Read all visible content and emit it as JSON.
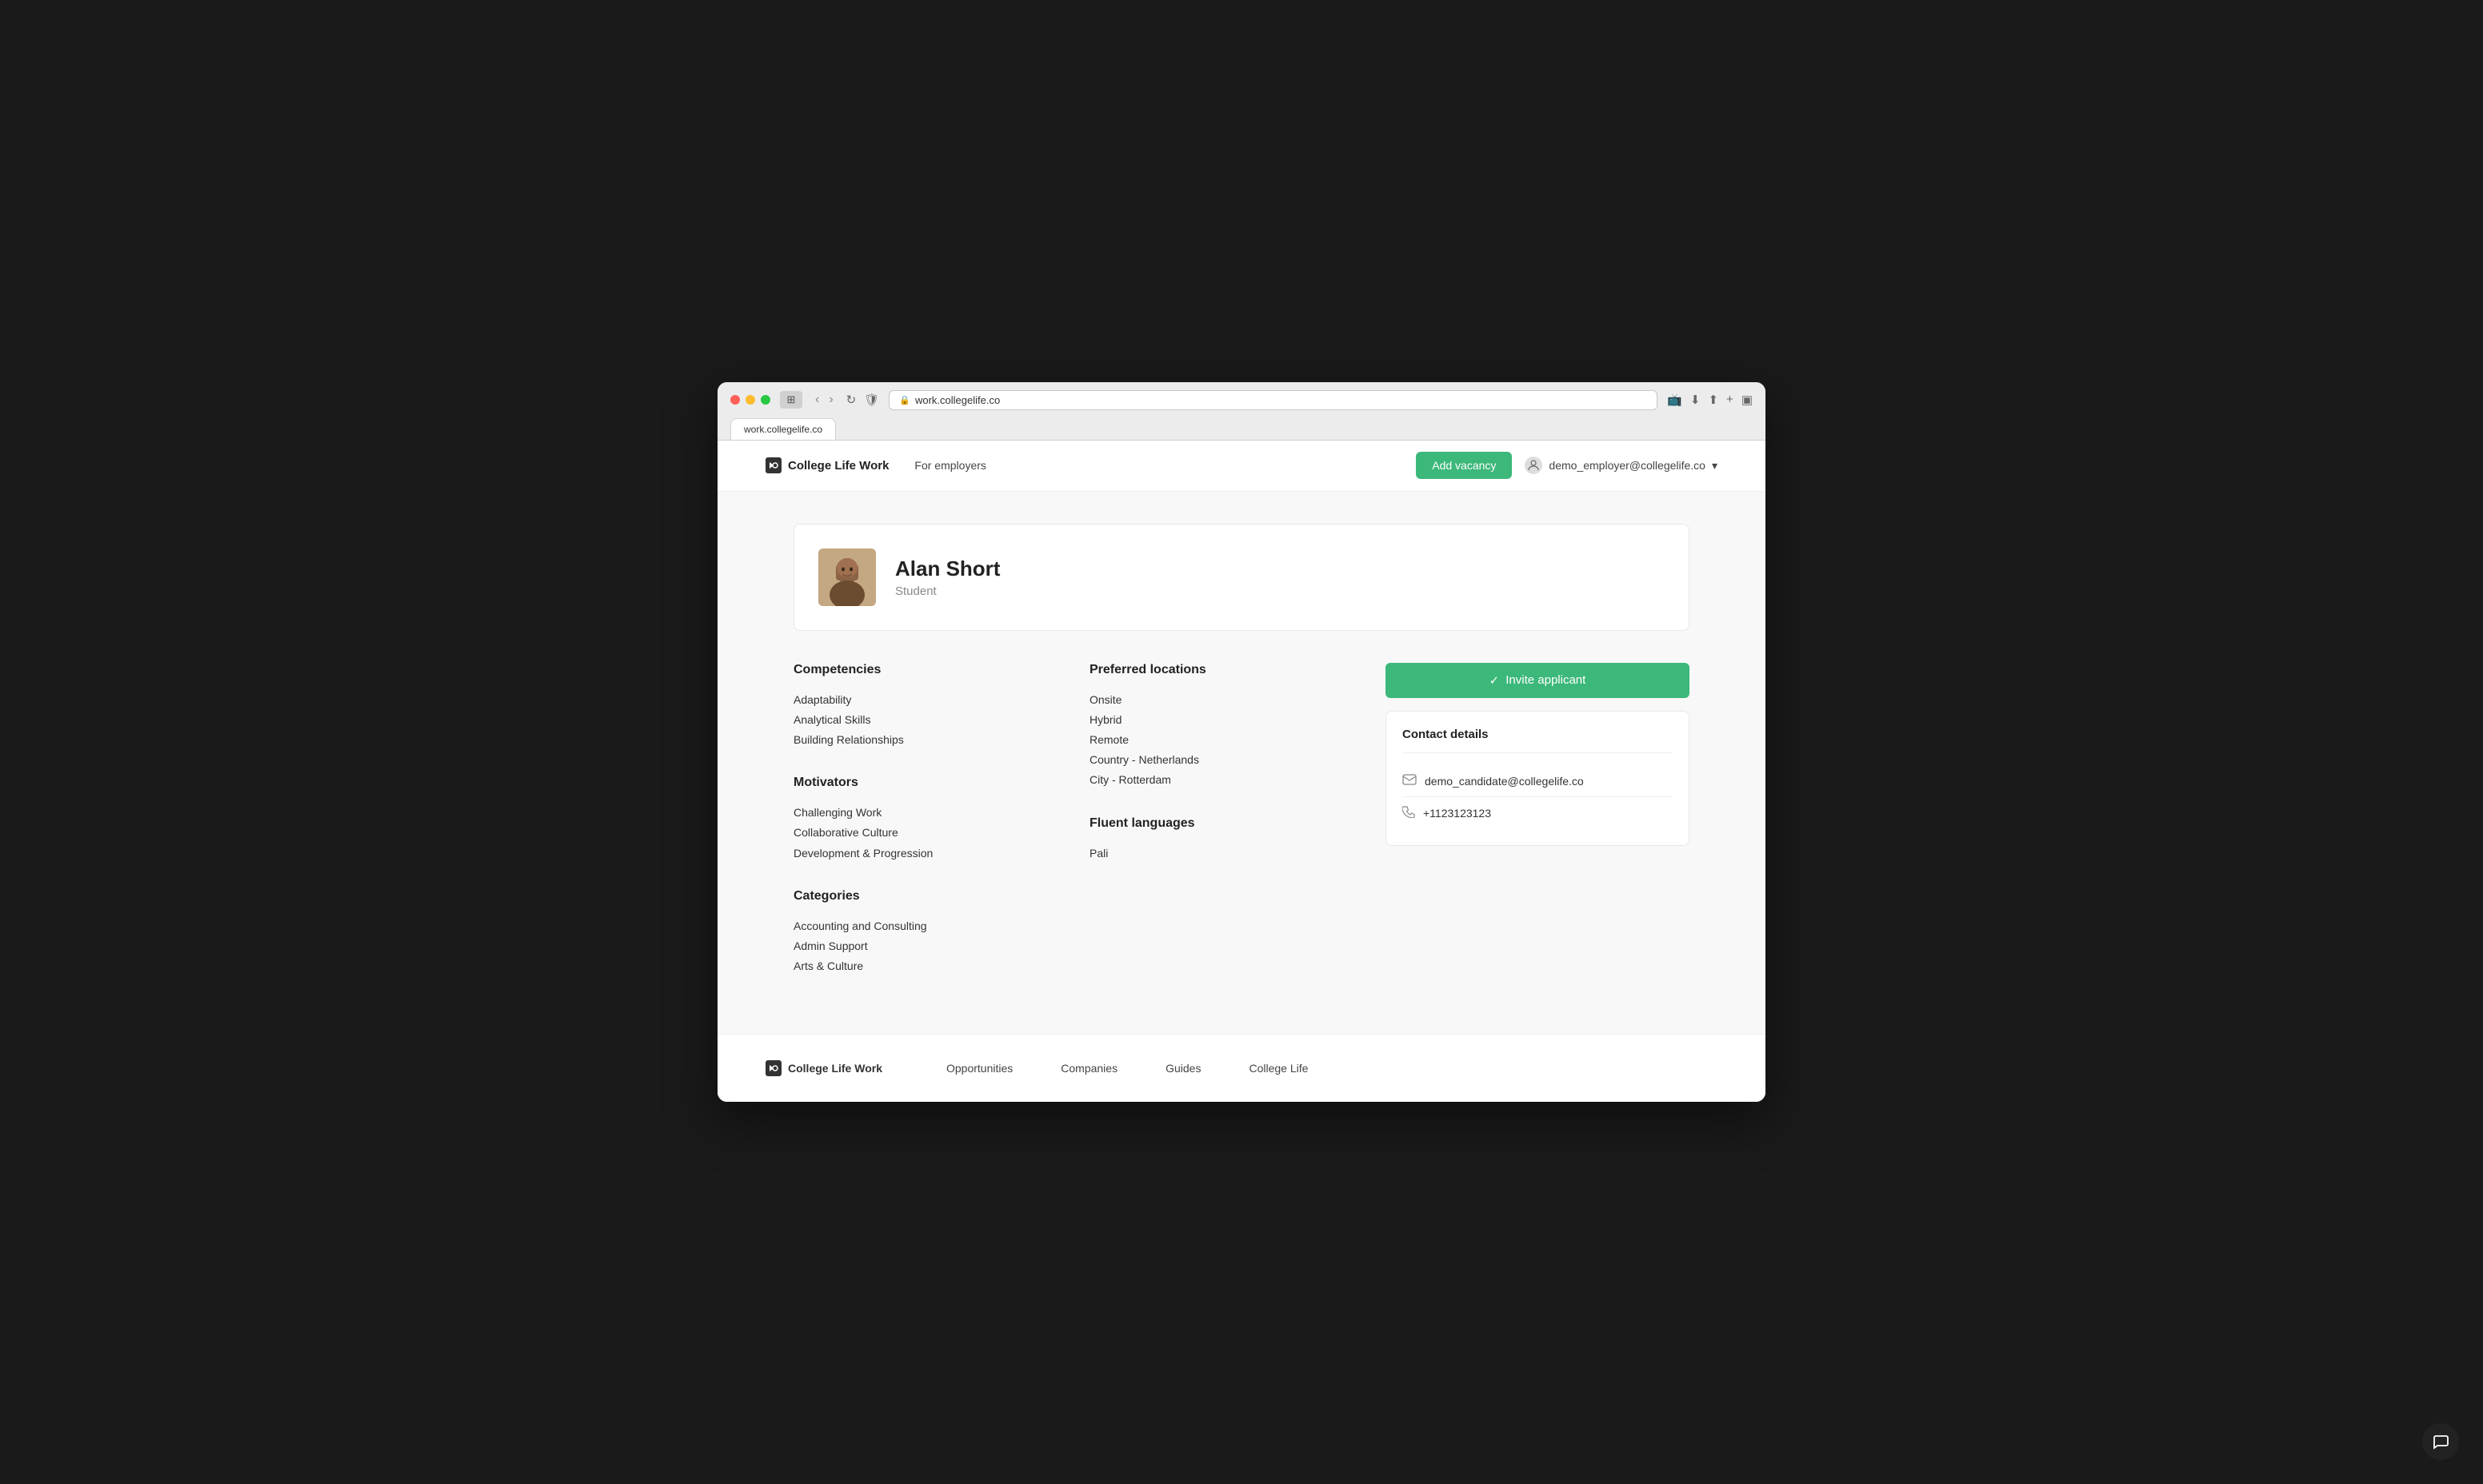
{
  "browser": {
    "url": "work.collegelife.co"
  },
  "nav": {
    "logo": "College Life Work",
    "logo_icon": "C",
    "for_employers": "For employers",
    "add_vacancy": "Add vacancy",
    "user_email": "demo_employer@collegelife.co"
  },
  "profile": {
    "name": "Alan Short",
    "role": "Student"
  },
  "competencies": {
    "title": "Competencies",
    "items": [
      "Adaptability",
      "Analytical Skills",
      "Building Relationships"
    ]
  },
  "motivators": {
    "title": "Motivators",
    "items": [
      "Challenging Work",
      "Collaborative Culture",
      "Development & Progression"
    ]
  },
  "categories": {
    "title": "Categories",
    "items": [
      "Accounting and Consulting",
      "Admin Support",
      "Arts & Culture"
    ]
  },
  "preferred_locations": {
    "title": "Preferred locations",
    "items": [
      "Onsite",
      "Hybrid",
      "Remote",
      "Country - Netherlands",
      "City - Rotterdam"
    ]
  },
  "fluent_languages": {
    "title": "Fluent languages",
    "items": [
      "Pali"
    ]
  },
  "invite_btn": "Invite applicant",
  "contact": {
    "title": "Contact details",
    "email": "demo_candidate@collegelife.co",
    "phone": "+1123123123"
  },
  "footer": {
    "logo": "College Life Work",
    "links": [
      "Opportunities",
      "Companies",
      "Guides",
      "College Life"
    ]
  }
}
